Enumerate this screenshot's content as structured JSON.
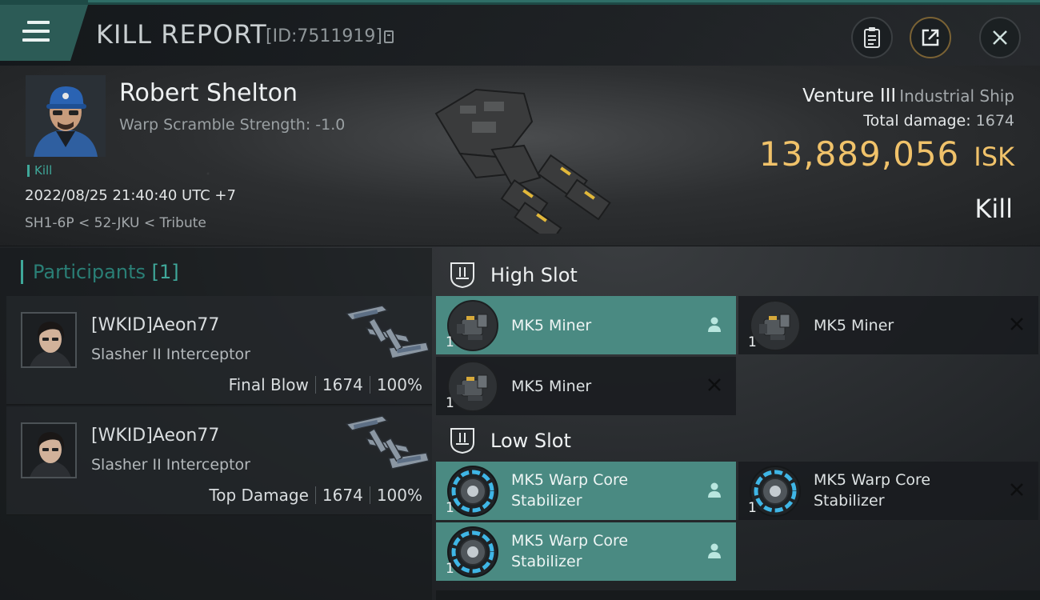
{
  "header": {
    "title": "KILL REPORT",
    "report_id": "[ID:7511919]",
    "menu_icon": "hamburger-icon",
    "buttons": {
      "clipboard": "clipboard-icon",
      "share": "share-icon",
      "close": "close-icon"
    }
  },
  "victim": {
    "name": "Robert Shelton",
    "warp_scramble": "Warp Scramble Strength: -1.0",
    "tag": "Kill",
    "datetime": "2022/08/25 21:40:40 UTC +7",
    "location": "SH1-6P < 52-JKU < Tribute",
    "ship_name": "Venture III",
    "ship_class": "Industrial Ship",
    "total_damage_label": "Total damage:",
    "total_damage": "1674",
    "isk_value": "13,889,056",
    "isk_unit": "ISK",
    "result": "Kill"
  },
  "participants": {
    "label": "Participants",
    "count": "[1]",
    "rows": [
      {
        "name": "[WKID]Aeon77",
        "ship": "Slasher II Interceptor",
        "role": "Final Blow",
        "damage": "1674",
        "percent": "100%"
      },
      {
        "name": "[WKID]Aeon77",
        "ship": "Slasher II Interceptor",
        "role": "Top Damage",
        "damage": "1674",
        "percent": "100%"
      }
    ]
  },
  "fittings": {
    "high_slot": {
      "label": "High Slot",
      "modules": [
        {
          "qty": "1",
          "name": "MK5 Miner",
          "status": "fitted"
        },
        {
          "qty": "1",
          "name": "MK5 Miner",
          "status": "destroyed"
        },
        {
          "qty": "1",
          "name": "MK5 Miner",
          "status": "destroyed"
        }
      ]
    },
    "low_slot": {
      "label": "Low Slot",
      "modules": [
        {
          "qty": "1",
          "name_line1": "MK5 Warp Core",
          "name_line2": "Stabilizer",
          "status": "fitted"
        },
        {
          "qty": "1",
          "name_line1": "MK5 Warp Core",
          "name_line2": "Stabilizer",
          "status": "destroyed"
        },
        {
          "qty": "1",
          "name_line1": "MK5 Warp Core",
          "name_line2": "Stabilizer",
          "status": "fitted"
        }
      ]
    }
  },
  "colors": {
    "accent_teal": "#3fa89a",
    "isk_gold": "#f0c26a",
    "active_module": "#4a8a82"
  }
}
